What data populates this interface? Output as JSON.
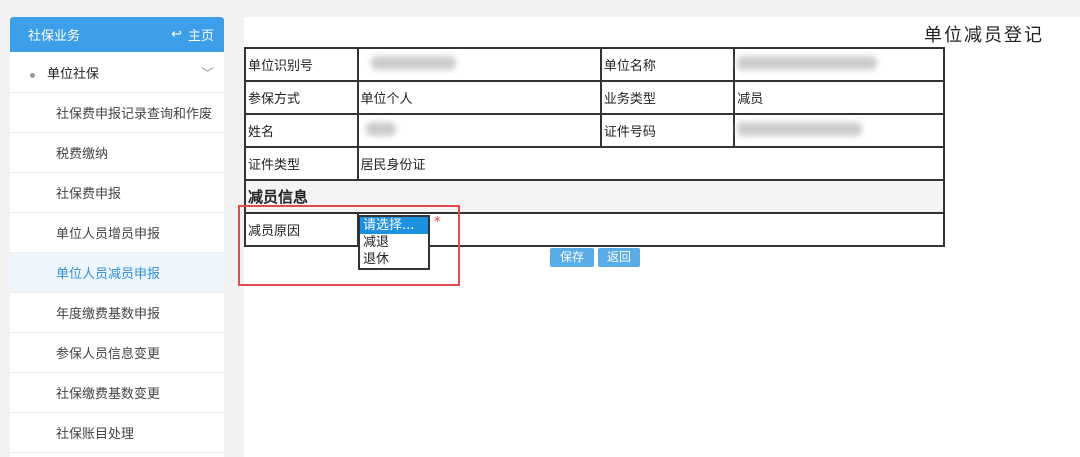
{
  "sidebar": {
    "header": "社保业务",
    "home": "主页",
    "group": "单位社保",
    "items": [
      "社保费申报记录查询和作废",
      "税费缴纳",
      "社保费申报",
      "单位人员增员申报",
      "单位人员减员申报",
      "年度缴费基数申报",
      "参保人员信息变更",
      "社保缴费基数变更",
      "社保账目处理"
    ],
    "active_index": 4
  },
  "main": {
    "title": "单位减员登记",
    "rows": {
      "unit_id_label": "单位识别号",
      "unit_name_label": "单位名称",
      "insure_mode_label": "参保方式",
      "insure_mode": "单位个人",
      "biz_type_label": "业务类型",
      "biz_type": "减员",
      "name_label": "姓名",
      "id_no_label": "证件号码",
      "id_type_label": "证件类型",
      "id_type": "居民身份证"
    },
    "section": "减员信息",
    "reason_label": "减员原因",
    "reason_options": [
      "请选择...",
      "减退",
      "退休"
    ],
    "required": "*",
    "save": "保存",
    "back": "返回"
  }
}
